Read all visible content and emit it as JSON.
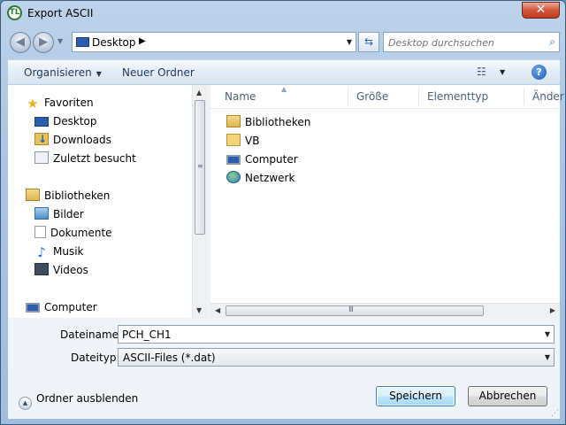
{
  "window": {
    "title": "Export ASCII",
    "app_icon_label": "TL",
    "close_glyph": "✕"
  },
  "navigation": {
    "back_glyph": "◀",
    "forward_glyph": "▶",
    "address": "Desktop",
    "refresh_glyph": "⇆",
    "search_placeholder": "Desktop durchsuchen"
  },
  "toolbar": {
    "organize_label": "Organisieren",
    "new_folder_label": "Neuer Ordner",
    "view_glyph": "☷",
    "help_glyph": "?"
  },
  "nav_pane": {
    "groups": [
      {
        "label": "Favoriten",
        "icon": "star-icon"
      },
      {
        "label": "Desktop",
        "icon": "desktop-icon"
      },
      {
        "label": "Downloads",
        "icon": "downloads-icon"
      },
      {
        "label": "Zuletzt besucht",
        "icon": "recent-places-icon"
      },
      {
        "label": "Bibliotheken",
        "icon": "libraries-icon"
      },
      {
        "label": "Bilder",
        "icon": "pictures-icon"
      },
      {
        "label": "Dokumente",
        "icon": "documents-icon"
      },
      {
        "label": "Musik",
        "icon": "music-icon"
      },
      {
        "label": "Videos",
        "icon": "videos-icon"
      },
      {
        "label": "Computer",
        "icon": "computer-icon"
      }
    ]
  },
  "file_list": {
    "columns": [
      "Name",
      "Größe",
      "Elementtyp",
      "Änder"
    ],
    "items": [
      {
        "name": "Bibliotheken",
        "icon": "libraries-icon"
      },
      {
        "name": "VB",
        "icon": "folder-icon"
      },
      {
        "name": "Computer",
        "icon": "computer-icon"
      },
      {
        "name": "Netzwerk",
        "icon": "network-icon"
      }
    ],
    "hscroll_grip": "III"
  },
  "form": {
    "filename_label": "Dateiname:",
    "filename_value": "PCH_CH1",
    "filetype_label": "Dateityp:",
    "filetype_value": "ASCII-Files (*.dat)"
  },
  "footer": {
    "hide_folders_label": "Ordner ausblenden",
    "save_label": "Speichern",
    "cancel_label": "Abbrechen"
  }
}
